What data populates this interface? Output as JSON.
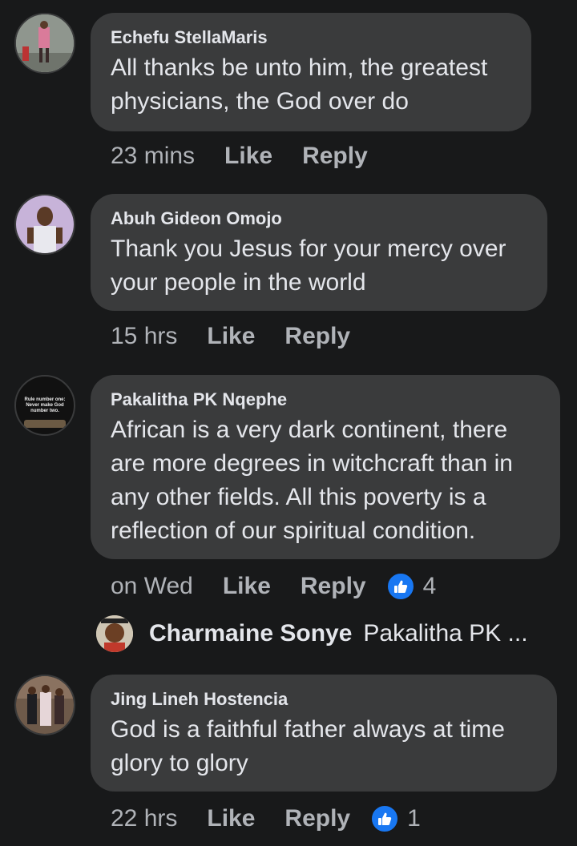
{
  "comments": [
    {
      "author": "Echefu StellaMaris",
      "text_lines": [
        "All thanks be unto him, the greatest",
        "physicians, the God over do"
      ],
      "time": "23 mins",
      "like_label": "Like",
      "reply_label": "Reply"
    },
    {
      "author": "Abuh Gideon Omojo",
      "text_lines": [
        "Thank you Jesus for your mercy over",
        "your people in the world"
      ],
      "time": "15 hrs",
      "like_label": "Like",
      "reply_label": "Reply"
    },
    {
      "author": "Pakalitha PK Nqephe",
      "avatar_text": [
        "Rule number one:",
        "Never make God",
        "number two."
      ],
      "text_lines": [
        "African is a very dark continent, there",
        "are more degrees in witchcraft than in",
        "any other fields. All this poverty is a",
        "reflection of our spiritual condition."
      ],
      "time": "on Wed",
      "like_label": "Like",
      "reply_label": "Reply",
      "reaction_count": "4"
    },
    {
      "author": "Jing Lineh Hostencia",
      "text_lines": [
        "God is a faithful father always at time",
        "glory to glory"
      ],
      "time": "22 hrs",
      "like_label": "Like",
      "reply_label": "Reply",
      "reaction_count": "1"
    }
  ],
  "reply_preview": {
    "author": "Charmaine Sonye",
    "text": "Pakalitha PK ..."
  },
  "colors": {
    "background": "#18191a",
    "bubble": "#3a3b3c",
    "text": "#e4e6eb",
    "secondary_text": "#b0b3b8",
    "like_blue": "#1877f2"
  },
  "icons": [
    "thumbs-up-icon"
  ]
}
